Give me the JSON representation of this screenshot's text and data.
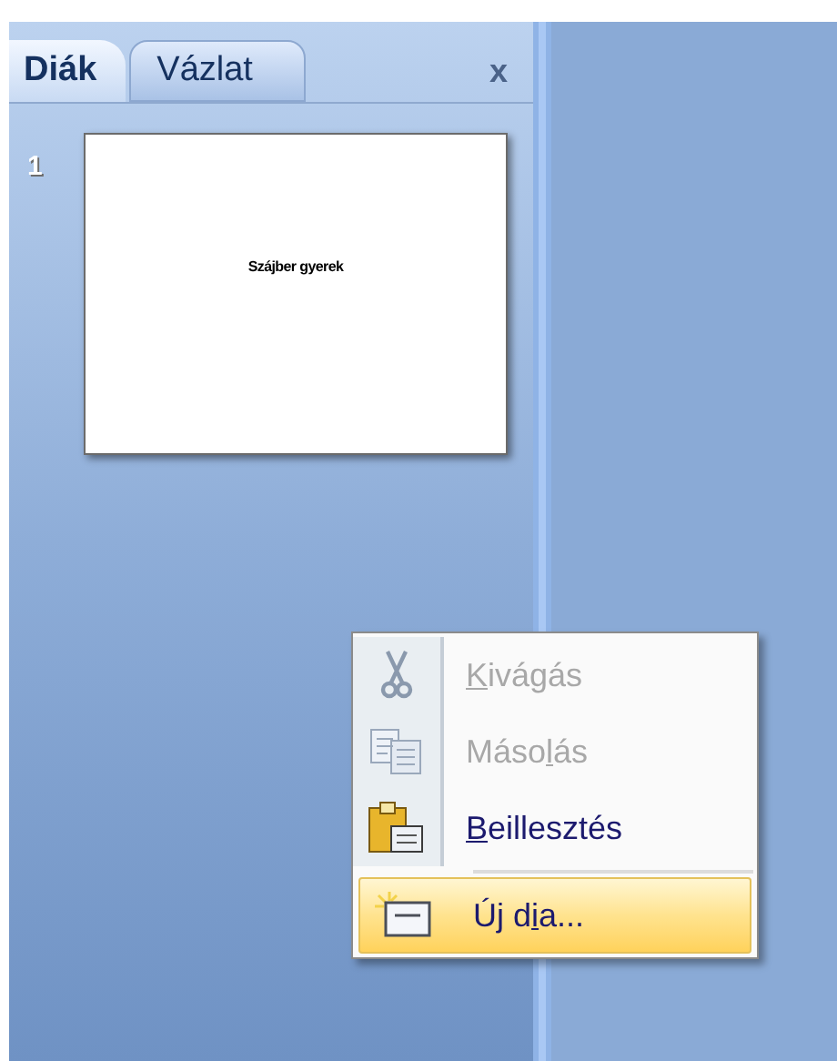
{
  "panel": {
    "tabs": [
      {
        "label": "Diák",
        "selected": true
      },
      {
        "label": "Vázlat",
        "selected": false
      }
    ],
    "close": "x",
    "slides": [
      {
        "number": "1",
        "title": "Szájber gyerek",
        "selected": false
      }
    ]
  },
  "context_menu": {
    "items": [
      {
        "kind": "cut",
        "access_key": "K",
        "label_after": "ivágás",
        "disabled": true,
        "selected": false
      },
      {
        "kind": "copy",
        "label_before": "Máso",
        "access_key": "l",
        "label_after": "ás",
        "disabled": true,
        "selected": false
      },
      {
        "kind": "paste",
        "access_key": "B",
        "label_after": "eillesztés",
        "disabled": false,
        "selected": false
      },
      {
        "kind": "new-slide",
        "label_before": "Új d",
        "access_key": "i",
        "label_after": "a...",
        "disabled": false,
        "selected": true
      }
    ]
  }
}
